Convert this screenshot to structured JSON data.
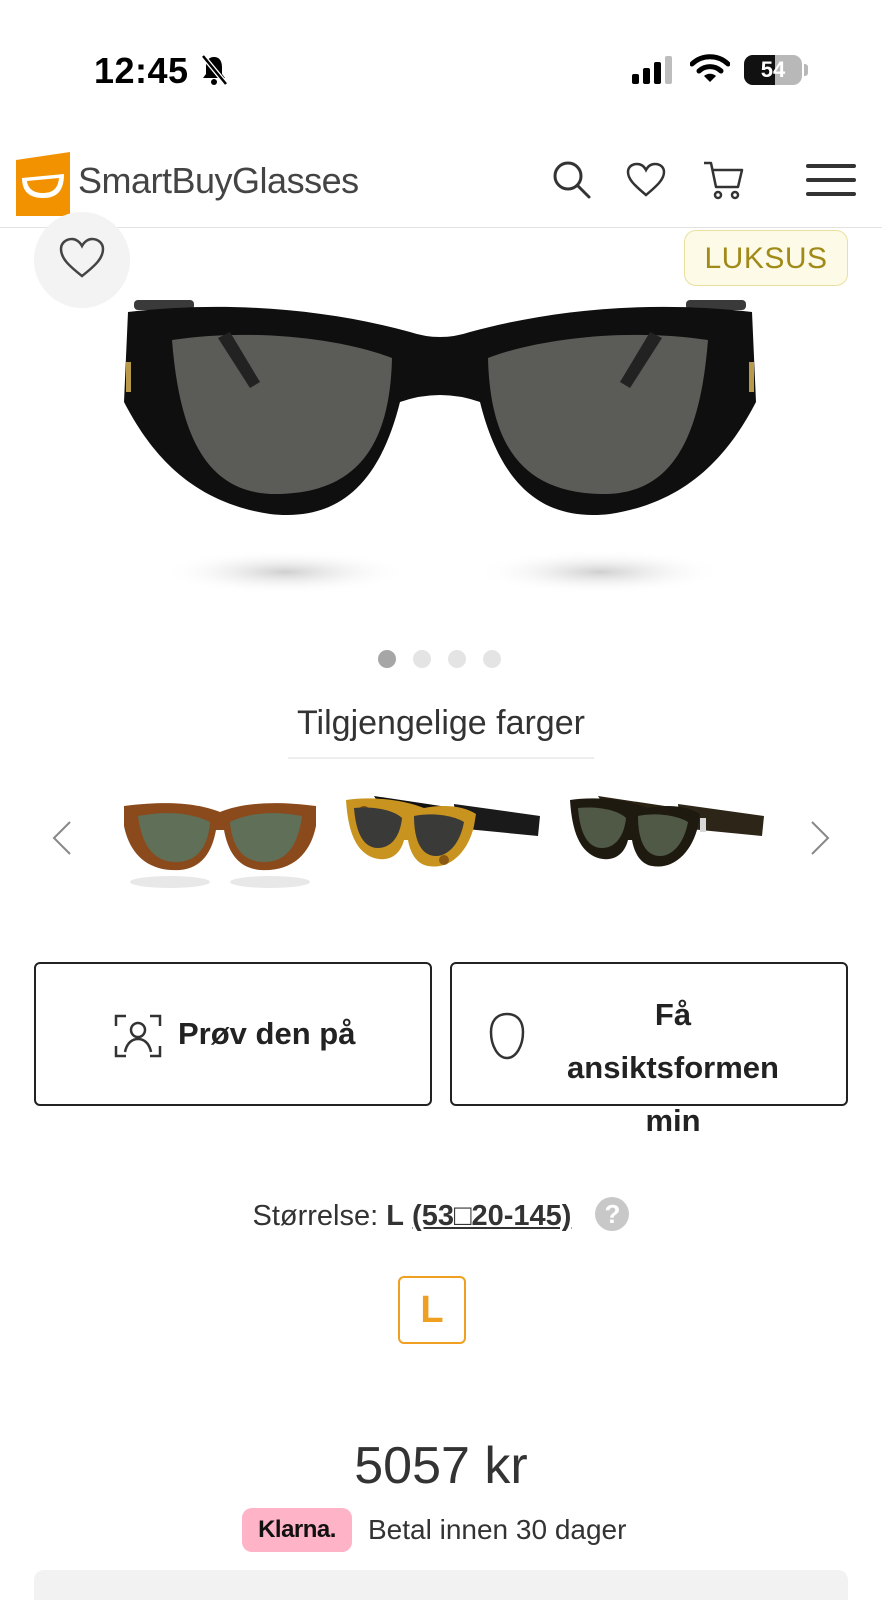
{
  "status_bar": {
    "time": "12:45",
    "battery": "54",
    "icons": [
      "bell-slash-icon",
      "signal-icon",
      "wifi-icon",
      "battery-icon"
    ]
  },
  "header": {
    "brand": "SmartBuyGlasses",
    "brand_color": "#f39200",
    "icons": [
      "search-icon",
      "heart-icon",
      "cart-icon",
      "menu-icon"
    ]
  },
  "product": {
    "badge": "LUKSUS",
    "image_count": 4,
    "active_image": 1
  },
  "colors_section": {
    "title": "Tilgjengelige farger",
    "variants": [
      "havana-green",
      "yellow-havana-black",
      "dark-havana-green"
    ]
  },
  "actions": {
    "try_on": "Prøv den på",
    "face_shape": "Få ansiktsformen min"
  },
  "size": {
    "label": "Størrelse:",
    "value": "L",
    "code": "(53□20-145)",
    "help": "?",
    "chip": "L"
  },
  "price": {
    "amount": "5057 kr"
  },
  "klarna": {
    "badge": "Klarna.",
    "text": "Betal innen 30 dager",
    "badge_color": "#ffb3c7"
  }
}
